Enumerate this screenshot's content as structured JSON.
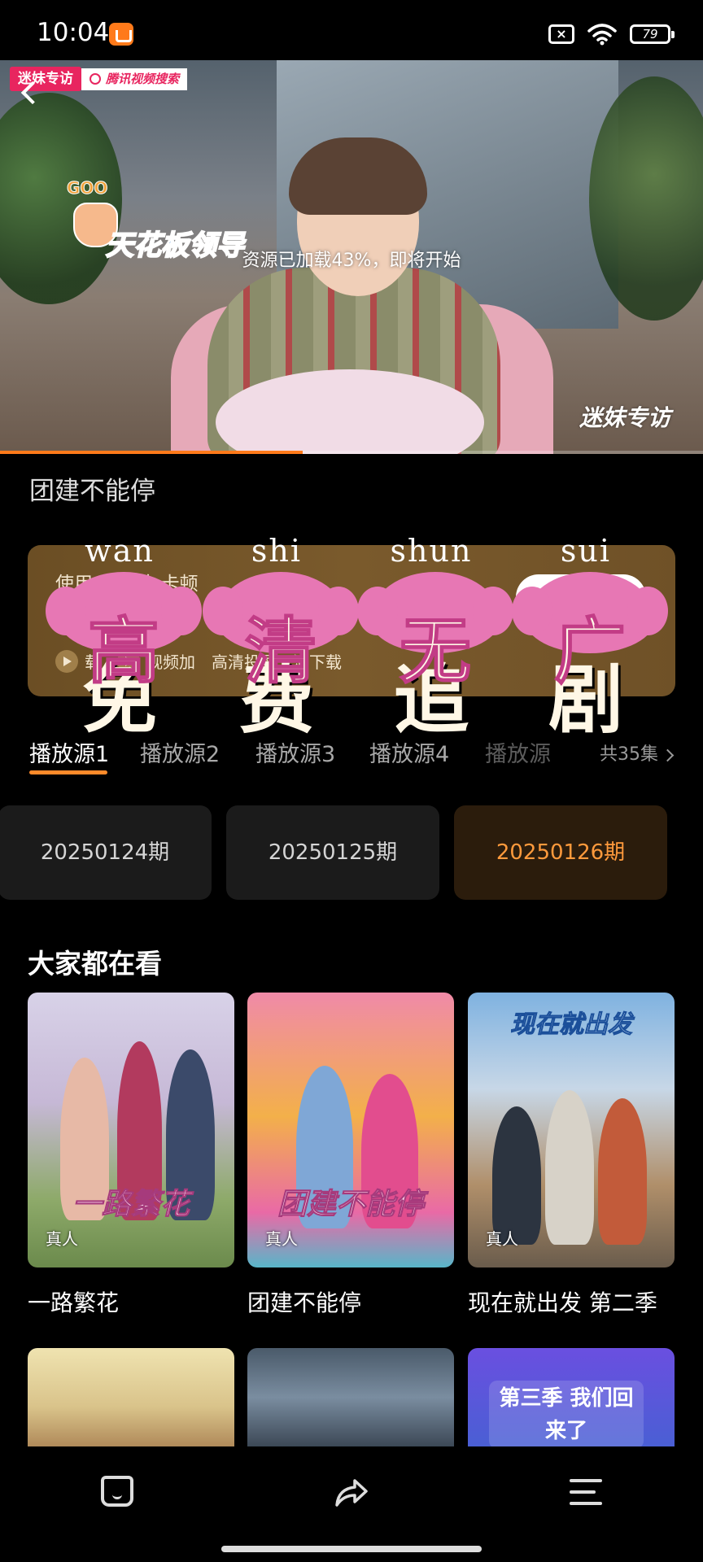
{
  "status_bar": {
    "time": "10:04",
    "battery": "79"
  },
  "video": {
    "source_tag": "迷妹专访",
    "search_tag": "腾讯视频搜索",
    "goo_text": "GOO",
    "caption": "天花板领导",
    "loading_text": "资源已加载43%，即将开始",
    "watermark": "迷妹专访",
    "load_progress": 0.43
  },
  "show_title": "团建不能停",
  "promo": {
    "line1": "使用 速播放  卡顿",
    "line2": "截等",
    "features": [
      "载",
      "视频加",
      "高清投屏",
      "清下载"
    ]
  },
  "overlay": {
    "pinyin": [
      "wan",
      "shi",
      "shun",
      "sui"
    ],
    "row1": [
      "高",
      "清",
      "无",
      "广"
    ],
    "row2": [
      "免",
      "费",
      "追",
      "剧"
    ]
  },
  "sources": {
    "tabs": [
      "播放源1",
      "播放源2",
      "播放源3",
      "播放源4",
      "播放源"
    ],
    "active_index": 0,
    "episode_count": "共35集"
  },
  "episodes": [
    {
      "label": "20250124期",
      "active": false
    },
    {
      "label": "20250125期",
      "active": false
    },
    {
      "label": "20250126期",
      "active": true
    }
  ],
  "recommended": {
    "title": "大家都在看",
    "items": [
      {
        "name": "一路繁花",
        "genre": "真人",
        "poster_text": "一路繁花"
      },
      {
        "name": "团建不能停",
        "genre": "真人",
        "poster_text": "团建不能停"
      },
      {
        "name": "现在就出发 第二季",
        "genre": "真人",
        "poster_text": "现在就出发"
      }
    ],
    "row2": [
      {
        "poster_text": ""
      },
      {
        "poster_text": ""
      },
      {
        "poster_text": "第三季 我们回来了"
      }
    ]
  },
  "colors": {
    "accent": "#ff8a2a",
    "episode_active_text": "#ff9a3c",
    "overlay_pink": "#e777b4"
  }
}
